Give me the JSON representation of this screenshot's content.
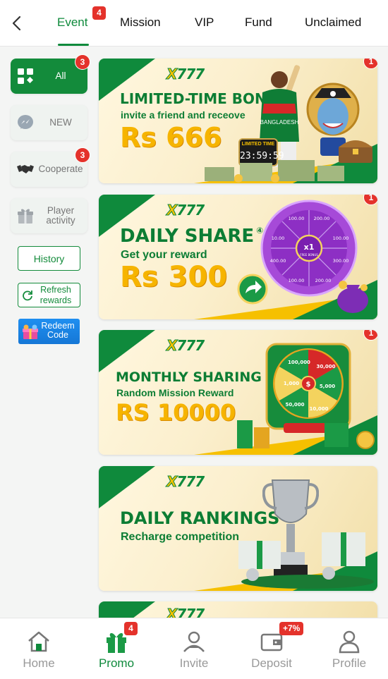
{
  "tabs": [
    {
      "label": "Event",
      "badge": "4",
      "active": true
    },
    {
      "label": "Mission"
    },
    {
      "label": "VIP"
    },
    {
      "label": "Fund"
    },
    {
      "label": "Unclaimed"
    }
  ],
  "sidebar": {
    "items": [
      {
        "label": "All",
        "badge": "3",
        "icon": "grid-icon",
        "active": true
      },
      {
        "label": "NEW",
        "icon": "messenger-icon"
      },
      {
        "label": "Cooperate",
        "badge": "3",
        "icon": "handshake-icon"
      },
      {
        "label": "Player activity",
        "icon": "gift-icon"
      }
    ],
    "history_label": "History",
    "refresh_label": "Refresh rewards",
    "redeem_label": "Redeem Code"
  },
  "banners": [
    {
      "logo": "X777",
      "title": "LIMITED-TIME BONUS",
      "subtitle": "invite a friend and receove",
      "amount": "Rs 666",
      "badge": "1",
      "timer_label": "LIMITED TIME",
      "timer": "23:59:59",
      "jersey": "BANGLADESH"
    },
    {
      "logo": "X777",
      "title": "DAILY SHARE",
      "title_mark": "④",
      "subtitle": "Get your reward",
      "amount": "Rs 300",
      "badge": "1",
      "wheel_center": "x1",
      "wheel_center_sub": "FREE BONUS",
      "wheel_values": [
        "200.00",
        "100.00",
        "300.00",
        "200.00",
        "100.00",
        "400.00",
        "10.00",
        "100.00"
      ]
    },
    {
      "logo": "X777",
      "title": "MONTHLY SHARING",
      "subtitle": "Random Mission Reward",
      "amount": "RS 10000",
      "badge": "1",
      "wheel_values": [
        "1,000",
        "50,000",
        "10,000",
        "30,000",
        "5,000",
        "100,000"
      ]
    },
    {
      "logo": "X777",
      "title": "DAILY RANKINGS",
      "subtitle": "Recharge competition"
    }
  ],
  "bottom_nav": [
    {
      "label": "Home",
      "icon": "home-icon"
    },
    {
      "label": "Promo",
      "icon": "promo-gift-icon",
      "badge": "4",
      "active": true
    },
    {
      "label": "Invite",
      "icon": "invite-icon"
    },
    {
      "label": "Deposit",
      "icon": "wallet-icon",
      "badge": "+7%"
    },
    {
      "label": "Profile",
      "icon": "profile-icon"
    }
  ],
  "colors": {
    "brand_green": "#0f8a3c",
    "badge_red": "#e4322b",
    "gold": "#f6b400",
    "redeem_blue": "#1f8ff0"
  }
}
